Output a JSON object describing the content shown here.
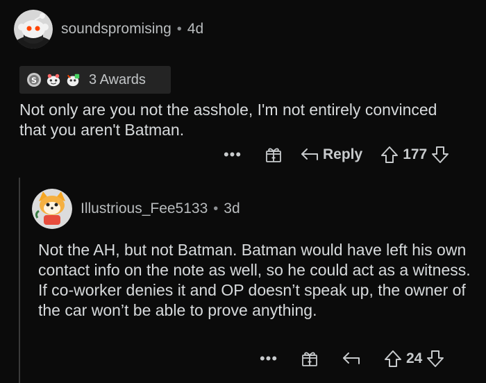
{
  "comments": [
    {
      "username": "soundspromising",
      "separator": "•",
      "age": "4d",
      "awards_label": "3 Awards",
      "award_icons": [
        "silver-award-icon",
        "wholesome-award-icon",
        "helpful-award-icon"
      ],
      "body": "Not only are you not the asshole, I'm not entirely convinced that you aren't Batman.",
      "more_label": "•••",
      "reply_label": "Reply",
      "score": "177"
    },
    {
      "username": "Illustrious_Fee5133",
      "separator": "•",
      "age": "3d",
      "body": "Not the AH, but not Batman. Batman would have left his own contact info on the note as well, so he could act as a witness. If co-worker denies it and OP doesn’t speak up, the owner of the car won’t be able to prove anything.",
      "more_label": "•••",
      "score": "24"
    }
  ],
  "colors": {
    "background": "#0b0b0b",
    "text": "#d7dadc",
    "muted": "#b9bcbe",
    "award_bg": "#242424",
    "thread_line": "#3a3a3a"
  }
}
